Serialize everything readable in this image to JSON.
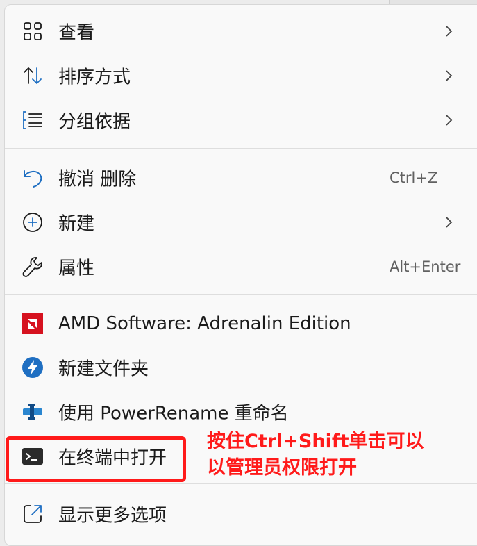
{
  "menu": {
    "items": [
      {
        "label": "查看",
        "icon": "grid-view-icon",
        "submenu": true
      },
      {
        "label": "排序方式",
        "icon": "sort-arrows-icon",
        "submenu": true
      },
      {
        "label": "分组依据",
        "icon": "group-list-icon",
        "submenu": true
      },
      {
        "label": "撤消 删除",
        "icon": "undo-icon",
        "shortcut": "Ctrl+Z"
      },
      {
        "label": "新建",
        "icon": "add-circle-icon",
        "submenu": true
      },
      {
        "label": "属性",
        "icon": "wrench-icon",
        "shortcut": "Alt+Enter"
      },
      {
        "label": "AMD Software: Adrenalin Edition",
        "icon": "amd-logo-icon"
      },
      {
        "label": "新建文件夹",
        "icon": "lightning-badge-icon"
      },
      {
        "label": "使用 PowerRename 重命名",
        "icon": "powerrename-icon"
      },
      {
        "label": "在终端中打开",
        "icon": "terminal-icon"
      },
      {
        "label": "显示更多选项",
        "icon": "open-external-icon"
      }
    ]
  },
  "annotation": {
    "line1": "按住Ctrl+Shift单击可以",
    "line2": "以管理员权限打开",
    "color": "#ff1a1a"
  },
  "colors": {
    "accent": "#1f6fc2",
    "amd_red": "#d6121f"
  }
}
